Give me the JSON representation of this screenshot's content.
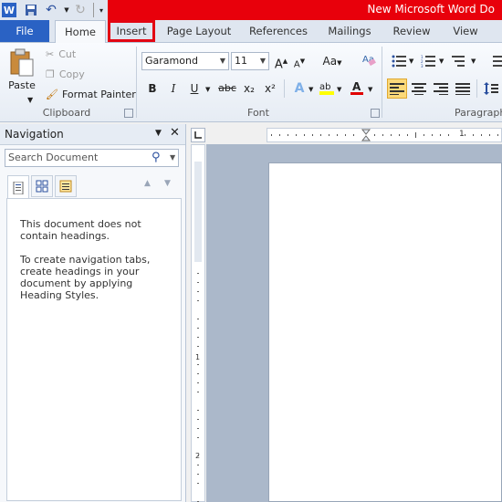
{
  "window": {
    "title": "New Microsoft Word Do"
  },
  "quick_access": {
    "icons": [
      "word-logo-icon",
      "save-icon",
      "undo-icon",
      "redo-icon",
      "customize-icon"
    ]
  },
  "tabs": [
    {
      "label": "File"
    },
    {
      "label": "Home"
    },
    {
      "label": "Insert"
    },
    {
      "label": "Page Layout"
    },
    {
      "label": "References"
    },
    {
      "label": "Mailings"
    },
    {
      "label": "Review"
    },
    {
      "label": "View"
    }
  ],
  "clipboard": {
    "paste": "Paste",
    "cut": "Cut",
    "copy": "Copy",
    "format_painter": "Format Painter",
    "label": "Clipboard"
  },
  "font": {
    "name": "Garamond",
    "size": "11",
    "grow": "A",
    "shrink": "A",
    "change_case": "Aa",
    "bold": "B",
    "italic": "I",
    "underline": "U",
    "strike": "abc",
    "subscript": "x₂",
    "superscript": "x²",
    "label": "Font"
  },
  "paragraph": {
    "label": "Paragraph"
  },
  "colors": {
    "highlight_color": "#ffff00",
    "font_color": "#e00000",
    "accent": "#e30613"
  },
  "navigation": {
    "title": "Navigation",
    "search_placeholder": "Search Document",
    "message_1": "This document does not contain headings.",
    "message_2": "To create navigation tabs, create headings in your document by applying Heading Styles."
  },
  "ruler": {
    "h_number": "1",
    "v_numbers": [
      "1",
      "2"
    ]
  }
}
